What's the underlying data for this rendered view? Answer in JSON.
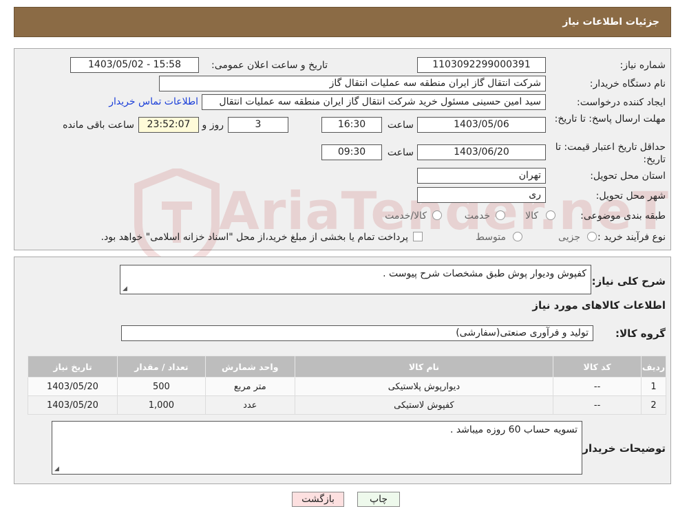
{
  "header": {
    "title": "جزئیات اطلاعات نیاز"
  },
  "fields": {
    "need_number_label": "شماره نیاز:",
    "need_number": "1103092299000391",
    "announce_label": "تاریخ و ساعت اعلان عمومی:",
    "announce_value": "1403/05/02 - 15:58",
    "buyer_org_label": "نام دستگاه خریدار:",
    "buyer_org": "شرکت انتقال گاز ایران منطقه سه عملیات انتقال گاز",
    "creator_label": "ایجاد کننده درخواست:",
    "creator": "سید امین حسینی مسئول خرید شرکت انتقال گاز ایران منطقه سه عملیات انتقال",
    "contact_link": "اطلاعات تماس خریدار",
    "deadline_label": "مهلت ارسال پاسخ: تا تاریخ:",
    "deadline_date": "1403/05/06",
    "hour_label": "ساعت",
    "deadline_time": "16:30",
    "days_value": "3",
    "day_and_label": "روز و",
    "remaining_time": "23:52:07",
    "remaining_label": "ساعت باقی مانده",
    "validity_label": "حداقل تاریخ اعتبار قیمت: تا تاریخ:",
    "validity_date": "1403/06/20",
    "validity_time": "09:30",
    "province_label": "استان محل تحویل:",
    "province": "تهران",
    "city_label": "شهر محل تحویل:",
    "city": "ری",
    "category_label": "طبقه بندی موضوعی:",
    "category_options": [
      "کالا",
      "خدمت",
      "کالا/خدمت"
    ],
    "process_label": "نوع فرآیند خرید :",
    "process_options": [
      "جزیی",
      "متوسط"
    ],
    "process_note": "پرداخت تمام یا بخشی از مبلغ خرید،از محل \"اسناد خزانه اسلامی\" خواهد بود."
  },
  "details": {
    "summary_label": "شرح کلی نیاز:",
    "summary": "کفپوش ودیوار پوش طبق مشخصات شرح پیوست .",
    "goods_info_title": "اطلاعات کالاهای مورد نیاز",
    "goods_group_label": "گروه کالا:",
    "goods_group": "تولید و فرآوری صنعتی(سفارشی)",
    "table": {
      "headers": [
        "ردیف",
        "کد کالا",
        "نام کالا",
        "واحد شمارش",
        "تعداد / مقدار",
        "تاریخ نیاز"
      ],
      "rows": [
        [
          "1",
          "--",
          "دیوارپوش پلاستیکی",
          "متر مربع",
          "500",
          "1403/05/20"
        ],
        [
          "2",
          "--",
          "کفپوش لاستیکی",
          "عدد",
          "1,000",
          "1403/05/20"
        ]
      ]
    },
    "buyer_notes_label": "توضیحات خریدار:",
    "buyer_notes": "تسویه حساب 60 روزه میباشد ."
  },
  "buttons": {
    "print": "چاپ",
    "back": "بازگشت"
  },
  "watermark": {
    "text": "AriaTender.neT"
  },
  "colors": {
    "header_bg": "#8B6B45",
    "link": "#1a3ed8",
    "back_btn_bg": "#fde0e0",
    "print_btn_bg": "#eef9ec"
  }
}
